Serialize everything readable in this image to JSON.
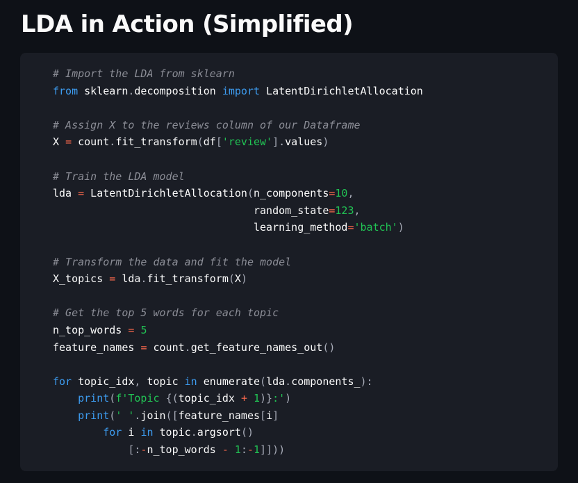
{
  "page": {
    "title": "LDA in Action (Simplified)"
  },
  "colors": {
    "background": "#0e1117",
    "code_background": "#1a1d25",
    "text": "#fafafa",
    "comment": "#8b8d96",
    "keyword": "#3d9cf0",
    "string": "#21c354",
    "number": "#21c354",
    "operator": "#ff6a4d",
    "punctuation": "#a8acb8"
  },
  "code": {
    "language": "python",
    "lines": [
      [
        [
          "comment",
          "# Import the LDA from sklearn"
        ]
      ],
      [
        [
          "keyword",
          "from"
        ],
        [
          "name",
          " sklearn"
        ],
        [
          "punct",
          "."
        ],
        [
          "name",
          "decomposition "
        ],
        [
          "keyword",
          "import"
        ],
        [
          "name",
          " LatentDirichletAllocation"
        ]
      ],
      [],
      [
        [
          "comment",
          "# Assign X to the reviews column of our Dataframe"
        ]
      ],
      [
        [
          "name",
          "X "
        ],
        [
          "operator",
          "="
        ],
        [
          "name",
          " count"
        ],
        [
          "punct",
          "."
        ],
        [
          "name",
          "fit_transform"
        ],
        [
          "punct",
          "("
        ],
        [
          "name",
          "df"
        ],
        [
          "punct",
          "["
        ],
        [
          "string",
          "'review'"
        ],
        [
          "punct",
          "]."
        ],
        [
          "name",
          "values"
        ],
        [
          "punct",
          ")"
        ]
      ],
      [],
      [
        [
          "comment",
          "# Train the LDA model"
        ]
      ],
      [
        [
          "name",
          "lda "
        ],
        [
          "operator",
          "="
        ],
        [
          "name",
          " LatentDirichletAllocation"
        ],
        [
          "punct",
          "("
        ],
        [
          "name",
          "n_components"
        ],
        [
          "operator",
          "="
        ],
        [
          "number",
          "10"
        ],
        [
          "punct",
          ","
        ]
      ],
      [
        [
          "name",
          "                                "
        ],
        [
          "name",
          "random_state"
        ],
        [
          "operator",
          "="
        ],
        [
          "number",
          "123"
        ],
        [
          "punct",
          ","
        ]
      ],
      [
        [
          "name",
          "                                "
        ],
        [
          "name",
          "learning_method"
        ],
        [
          "operator",
          "="
        ],
        [
          "string",
          "'batch'"
        ],
        [
          "punct",
          ")"
        ]
      ],
      [],
      [
        [
          "comment",
          "# Transform the data and fit the model"
        ]
      ],
      [
        [
          "name",
          "X_topics "
        ],
        [
          "operator",
          "="
        ],
        [
          "name",
          " lda"
        ],
        [
          "punct",
          "."
        ],
        [
          "name",
          "fit_transform"
        ],
        [
          "punct",
          "("
        ],
        [
          "name",
          "X"
        ],
        [
          "punct",
          ")"
        ]
      ],
      [],
      [
        [
          "comment",
          "# Get the top 5 words for each topic"
        ]
      ],
      [
        [
          "name",
          "n_top_words "
        ],
        [
          "operator",
          "="
        ],
        [
          "name",
          " "
        ],
        [
          "number",
          "5"
        ]
      ],
      [
        [
          "name",
          "feature_names "
        ],
        [
          "operator",
          "="
        ],
        [
          "name",
          " count"
        ],
        [
          "punct",
          "."
        ],
        [
          "name",
          "get_feature_names_out"
        ],
        [
          "punct",
          "()"
        ]
      ],
      [],
      [
        [
          "keyword",
          "for"
        ],
        [
          "name",
          " topic_idx"
        ],
        [
          "punct",
          ","
        ],
        [
          "name",
          " topic "
        ],
        [
          "keyword",
          "in"
        ],
        [
          "name",
          " enumerate"
        ],
        [
          "punct",
          "("
        ],
        [
          "name",
          "lda"
        ],
        [
          "punct",
          "."
        ],
        [
          "name",
          "components_"
        ],
        [
          "punct",
          "):"
        ]
      ],
      [
        [
          "name",
          "    "
        ],
        [
          "builtin",
          "print"
        ],
        [
          "punct",
          "("
        ],
        [
          "string",
          "f'Topic "
        ],
        [
          "punct",
          "{("
        ],
        [
          "name",
          "topic_idx "
        ],
        [
          "operator",
          "+"
        ],
        [
          "name",
          " "
        ],
        [
          "number",
          "1"
        ],
        [
          "punct",
          ")}"
        ],
        [
          "string",
          ":'"
        ],
        [
          "punct",
          ")"
        ]
      ],
      [
        [
          "name",
          "    "
        ],
        [
          "builtin",
          "print"
        ],
        [
          "punct",
          "("
        ],
        [
          "string",
          "' '"
        ],
        [
          "punct",
          "."
        ],
        [
          "name",
          "join"
        ],
        [
          "punct",
          "(["
        ],
        [
          "name",
          "feature_names"
        ],
        [
          "punct",
          "["
        ],
        [
          "name",
          "i"
        ],
        [
          "punct",
          "]"
        ]
      ],
      [
        [
          "name",
          "        "
        ],
        [
          "keyword",
          "for"
        ],
        [
          "name",
          " i "
        ],
        [
          "keyword",
          "in"
        ],
        [
          "name",
          " topic"
        ],
        [
          "punct",
          "."
        ],
        [
          "name",
          "argsort"
        ],
        [
          "punct",
          "()"
        ]
      ],
      [
        [
          "name",
          "            "
        ],
        [
          "punct",
          "[:"
        ],
        [
          "operator",
          "-"
        ],
        [
          "name",
          "n_top_words "
        ],
        [
          "operator",
          "-"
        ],
        [
          "name",
          " "
        ],
        [
          "number",
          "1"
        ],
        [
          "punct",
          ":"
        ],
        [
          "operator",
          "-"
        ],
        [
          "number",
          "1"
        ],
        [
          "punct",
          "]]))"
        ]
      ]
    ]
  }
}
